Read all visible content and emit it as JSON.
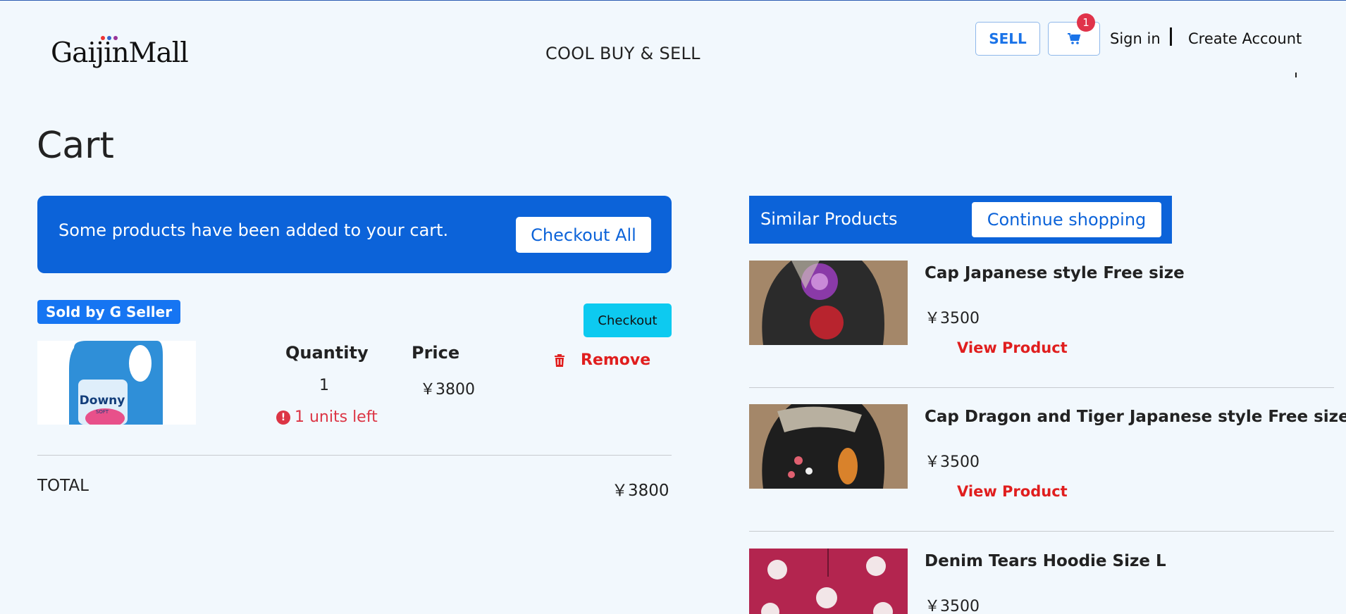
{
  "header": {
    "logo": "GaijinMall",
    "tagline": "COOL BUY & SELL",
    "sell_label": "SELL",
    "cart_count": "1",
    "signin_label": "Sign in",
    "create_account_label": "Create Account"
  },
  "page": {
    "title": "Cart"
  },
  "cart": {
    "alert_text": "Some products have been added to your cart.",
    "checkout_all_label": "Checkout All",
    "seller_label": "Sold by G Seller",
    "checkout_label": "Checkout",
    "item": {
      "quantity_header": "Quantity",
      "price_header": "Price",
      "quantity": "1",
      "price": "￥3800",
      "stock_text": "1 units left",
      "remove_label": "Remove"
    },
    "total_label": "TOTAL",
    "total_value": "￥3800"
  },
  "similar": {
    "title": "Similar Products",
    "continue_label": "Continue shopping",
    "items": [
      {
        "name": "Cap Japanese style Free size",
        "price": "￥3500",
        "view_label": "View Product"
      },
      {
        "name": "Cap Dragon and Tiger Japanese style Free size",
        "price": "￥3500",
        "view_label": "View Product"
      },
      {
        "name": "Denim Tears Hoodie Size L",
        "price": "￥3500"
      }
    ]
  },
  "colors": {
    "primary": "#0c63d9",
    "danger": "#e01e1e",
    "info": "#0dcaf0",
    "background": "#f2f8fd"
  }
}
